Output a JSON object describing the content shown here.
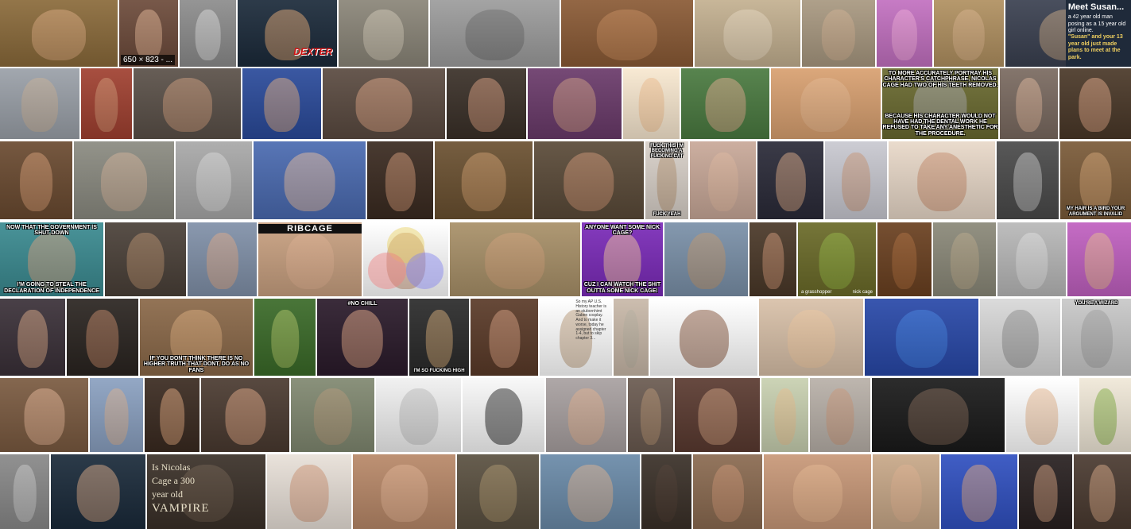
{
  "page": {
    "background": "#ffffff"
  },
  "rows": [
    {
      "tiles": [
        {
          "name": "image-tile",
          "bg": "#8a6a3a",
          "face": "#d9a57a"
        },
        {
          "name": "image-tile",
          "bg": "#6c4a3a",
          "face": "#e0b090",
          "size_badge": "650 × 823 - ..."
        },
        {
          "name": "image-tile",
          "bg": "#8c8c8c",
          "face": "#d8d8d8"
        },
        {
          "name": "image-tile",
          "bg": "#1b2a3a",
          "face": "#d8a070",
          "logo": "DEXTER"
        },
        {
          "name": "image-tile",
          "bg": "#8a8578",
          "face": "#cfc6b5"
        },
        {
          "name": "image-tile",
          "bg": "#9c9c9c",
          "face": "#6e6e6e"
        },
        {
          "name": "image-tile",
          "bg": "#8a5a35",
          "face": "#c48858"
        },
        {
          "name": "image-tile",
          "bg": "#c3b090",
          "face": "#e8d8c0"
        },
        {
          "name": "image-tile",
          "bg": "#a89880",
          "face": "#d0b090"
        },
        {
          "name": "image-tile",
          "bg": "#c270c0",
          "face": "#f0a8d8"
        },
        {
          "name": "image-tile",
          "bg": "#b09060",
          "face": "#d8b088"
        },
        {
          "name": "image-tile",
          "bg": "#3a4050",
          "face": "#c0a080",
          "panel_title": "Meet Susan...",
          "panel_line1": "a 42 year old man posing as a 15 year old girl online.",
          "panel_line2": "\"Susan\" and your 13 year old just made plans to meet at the park."
        }
      ]
    },
    {
      "tiles": [
        {
          "name": "image-tile",
          "bg": "#9aa0a8",
          "face": "#c8b098"
        },
        {
          "name": "image-tile",
          "bg": "#a04030",
          "face": "#d09070"
        },
        {
          "name": "image-tile",
          "bg": "#5a5048",
          "face": "#c89878"
        },
        {
          "name": "image-tile",
          "bg": "#2a4a9a",
          "face": "#d8a880"
        },
        {
          "name": "image-tile",
          "bg": "#5a4a40",
          "face": "#d8a080"
        },
        {
          "name": "image-tile",
          "bg": "#3a3028",
          "face": "#d09878"
        },
        {
          "name": "image-tile",
          "bg": "#6a3a6a",
          "face": "#c89880"
        },
        {
          "name": "image-tile",
          "bg": "#f8e8d0",
          "face": "#f0c090"
        },
        {
          "name": "image-tile",
          "bg": "#4a7a40",
          "face": "#d8a888"
        },
        {
          "name": "image-tile",
          "bg": "#d8a070",
          "face": "#e8b890"
        },
        {
          "name": "image-tile",
          "bg": "#6a6a30",
          "face": "#a8a8a8",
          "top_text": "To more accurately portray his character's catchphrase, Nicolas Cage had two of his teeth removed.",
          "bottom_text": "Because his character would not have had the dental work he refused to take any anesthetic for the procedure."
        },
        {
          "name": "image-tile",
          "bg": "#7a6a60",
          "face": "#d8b098"
        },
        {
          "name": "image-tile",
          "bg": "#4a3828",
          "face": "#d8a080"
        }
      ]
    },
    {
      "tiles": [
        {
          "name": "image-tile",
          "bg": "#6a4a30",
          "face": "#d09870"
        },
        {
          "name": "image-tile",
          "bg": "#8a8a80",
          "face": "#d0b098"
        },
        {
          "name": "image-tile",
          "bg": "#a8a8a8",
          "face": "#d8d8d8"
        },
        {
          "name": "image-tile",
          "bg": "#4a6ab0",
          "face": "#e0b8a0"
        },
        {
          "name": "image-tile",
          "bg": "#3a2a20",
          "face": "#c89070"
        },
        {
          "name": "image-tile",
          "bg": "#6a5030",
          "face": "#c89868"
        },
        {
          "name": "image-tile",
          "bg": "#5a4a38",
          "face": "#c89070"
        },
        {
          "name": "image-tile",
          "bg": "#d8d0c8",
          "face": "#b89878",
          "top_text": "fuck this i'm becoming a fucking cat",
          "bottom_text": "fuck yeah"
        },
        {
          "name": "image-tile",
          "bg": "#c8a898",
          "face": "#e0b8a0"
        },
        {
          "name": "image-tile",
          "bg": "#2a2a38",
          "face": "#d0a080"
        },
        {
          "name": "image-tile",
          "bg": "#c8c8d0",
          "face": "#c89878"
        },
        {
          "name": "image-tile",
          "bg": "#e8d8c8",
          "face": "#c89070"
        },
        {
          "name": "image-tile",
          "bg": "#4a4a4a",
          "face": "#c0c0c0"
        },
        {
          "name": "image-tile",
          "bg": "#7a5a38",
          "face": "#d0a070",
          "bottom_text": "MY HAIR IS A BIRD YOUR ARGUMENT IS INVALID"
        }
      ]
    },
    {
      "tiles": [
        {
          "name": "image-tile",
          "bg": "#3a8a90",
          "face": "#d0a080",
          "top_text": "NOW THAT THE GOVERNMENT IS SHUT DOWN",
          "bottom_text": "I'M GOING TO STEAL THE DECLARATION OF INDEPENDENCE"
        },
        {
          "name": "image-tile",
          "bg": "#4a4038",
          "face": "#b08868"
        },
        {
          "name": "image-tile",
          "bg": "#8090a8",
          "face": "#d8a888"
        },
        {
          "name": "image-tile",
          "bg": "#c8a080",
          "face": "#e0b090",
          "title_text": "RIBCAGE"
        },
        {
          "name": "image-tile",
          "bg": "#ffffff",
          "face": "#c89878",
          "venn": true
        },
        {
          "name": "image-tile",
          "bg": "#a89068",
          "face": "#d0a078"
        },
        {
          "name": "image-tile",
          "bg": "#7a2ab8",
          "face": "#f0c0a0",
          "top_text": "ANYONE WANT SOME NICK CAGE?",
          "bottom_text": "CUZ I CAN WATCH THE SHIT OUTTA SOME NICK CAGE!"
        },
        {
          "name": "image-tile",
          "bg": "#7a90a8",
          "face": "#c09870"
        },
        {
          "name": "image-tile",
          "bg": "#4a3828",
          "face": "#c89070"
        },
        {
          "name": "image-tile",
          "bg": "#6a6a28",
          "face": "#90b040",
          "caption_left": "a grasshopper",
          "caption_right": "nick cage"
        },
        {
          "name": "image-tile",
          "bg": "#6a4020",
          "face": "#a86838"
        },
        {
          "name": "image-tile",
          "bg": "#8a8878",
          "face": "#b8a888"
        },
        {
          "name": "image-tile",
          "bg": "#b8b8b8",
          "face": "#e0e0e0"
        },
        {
          "name": "image-tile",
          "bg": "#c060c0",
          "face": "#e8b890"
        }
      ]
    },
    {
      "tiles": [
        {
          "name": "image-tile",
          "bg": "#3a3038",
          "face": "#d0a080"
        },
        {
          "name": "image-tile",
          "bg": "#2a2420",
          "face": "#b88060"
        },
        {
          "name": "image-tile",
          "bg": "#8a6848",
          "face": "#d8a878",
          "bottom_text": "if you don't think there is no higher truth that dont, do as no fans"
        },
        {
          "name": "image-tile",
          "bg": "#3a6a28",
          "face": "#a8c060"
        },
        {
          "name": "image-tile",
          "bg": "#2a1a2a",
          "face": "#d8a080",
          "top_text": "#NO CHILL"
        },
        {
          "name": "image-tile",
          "bg": "#2a2a2a",
          "face": "#c8a070",
          "bottom_text": "I'M SO FUCKING HIGH"
        },
        {
          "name": "image-tile",
          "bg": "#5a3a28",
          "face": "#d09878"
        },
        {
          "name": "image-tile",
          "bg": "#ffffff",
          "face": "#c0a080",
          "notes": "So my AP U.S. History teacher is an stubornhimt Gaben cosplay. And to make it worse, today he assigned chapter 1-4, but to skip chapter 3..."
        },
        {
          "name": "image-tile",
          "bg": "#c8b8a8",
          "face": "#b8b0a0"
        },
        {
          "name": "image-tile",
          "bg": "#ffffff",
          "face": "#8a5a40"
        },
        {
          "name": "image-tile",
          "bg": "#d8c0a8",
          "face": "#f0c8a0"
        },
        {
          "name": "image-tile",
          "bg": "#2848a8",
          "face": "#4080e0"
        },
        {
          "name": "image-tile",
          "bg": "#d8d8d8",
          "face": "#909090"
        },
        {
          "name": "image-tile",
          "bg": "#c8c8c8",
          "face": "#a0a0a0",
          "top_text": "you're a wizard"
        }
      ]
    },
    {
      "tiles": [
        {
          "name": "image-tile",
          "bg": "#7a5a40",
          "face": "#e0b090"
        },
        {
          "name": "image-tile",
          "bg": "#8aa0c0",
          "face": "#d8b090"
        },
        {
          "name": "image-tile",
          "bg": "#3a2a20",
          "face": "#d8a078"
        },
        {
          "name": "image-tile",
          "bg": "#4a3a30",
          "face": "#d8a080"
        },
        {
          "name": "image-tile",
          "bg": "#808870",
          "face": "#b09878"
        },
        {
          "name": "image-tile",
          "bg": "#f0f0f0",
          "face": "#c0c0c0"
        },
        {
          "name": "image-tile",
          "bg": "#f8f8f8",
          "face": "#2a2a2a"
        },
        {
          "name": "image-tile",
          "bg": "#a8a0a0",
          "face": "#e0b090"
        },
        {
          "name": "image-tile",
          "bg": "#6a5a50",
          "face": "#b09070"
        },
        {
          "name": "image-tile",
          "bg": "#5a3a30",
          "face": "#c89878"
        },
        {
          "name": "image-tile",
          "bg": "#c8d0b0",
          "face": "#e8c090"
        },
        {
          "name": "image-tile",
          "bg": "#b8b0a8",
          "face": "#c89878"
        },
        {
          "name": "image-tile",
          "bg": "#1a1a1a",
          "face": "#7a6050"
        },
        {
          "name": "image-tile",
          "bg": "#ffffff",
          "face": "#e8b890"
        },
        {
          "name": "image-tile",
          "bg": "#f0e8d8",
          "face": "#88b048"
        }
      ]
    },
    {
      "tiles": [
        {
          "name": "image-tile",
          "bg": "#888888",
          "face": "#c8c8c8"
        },
        {
          "name": "image-tile",
          "bg": "#1a2a3a",
          "face": "#d0a080"
        },
        {
          "name": "image-tile",
          "bg": "#3a3028",
          "face": "#6a5a48",
          "serif_text": [
            "Is Nicolas",
            "Cage a 300",
            "year old",
            "VAMPIRE"
          ]
        },
        {
          "name": "image-tile",
          "bg": "#e8e0d8",
          "face": "#d09878"
        },
        {
          "name": "image-tile",
          "bg": "#b88868",
          "face": "#e0b090"
        },
        {
          "name": "image-tile",
          "bg": "#5a5040",
          "face": "#a89068"
        },
        {
          "name": "image-tile",
          "bg": "#6a8aa8",
          "face": "#d8b090"
        },
        {
          "name": "image-tile",
          "bg": "#3a3028",
          "face": "#4a3a30"
        },
        {
          "name": "image-tile",
          "bg": "#8a6a50",
          "face": "#c89070"
        },
        {
          "name": "image-tile",
          "bg": "#c89878",
          "face": "#e8b890"
        },
        {
          "name": "image-tile",
          "bg": "#c8a888",
          "face": "#e0b090"
        },
        {
          "name": "image-tile",
          "bg": "#3050c0",
          "face": "#d8a080"
        },
        {
          "name": "image-tile",
          "bg": "#282020",
          "face": "#c89878"
        },
        {
          "name": "image-tile",
          "bg": "#4a3a30",
          "face": "#d0a080"
        }
      ]
    }
  ]
}
